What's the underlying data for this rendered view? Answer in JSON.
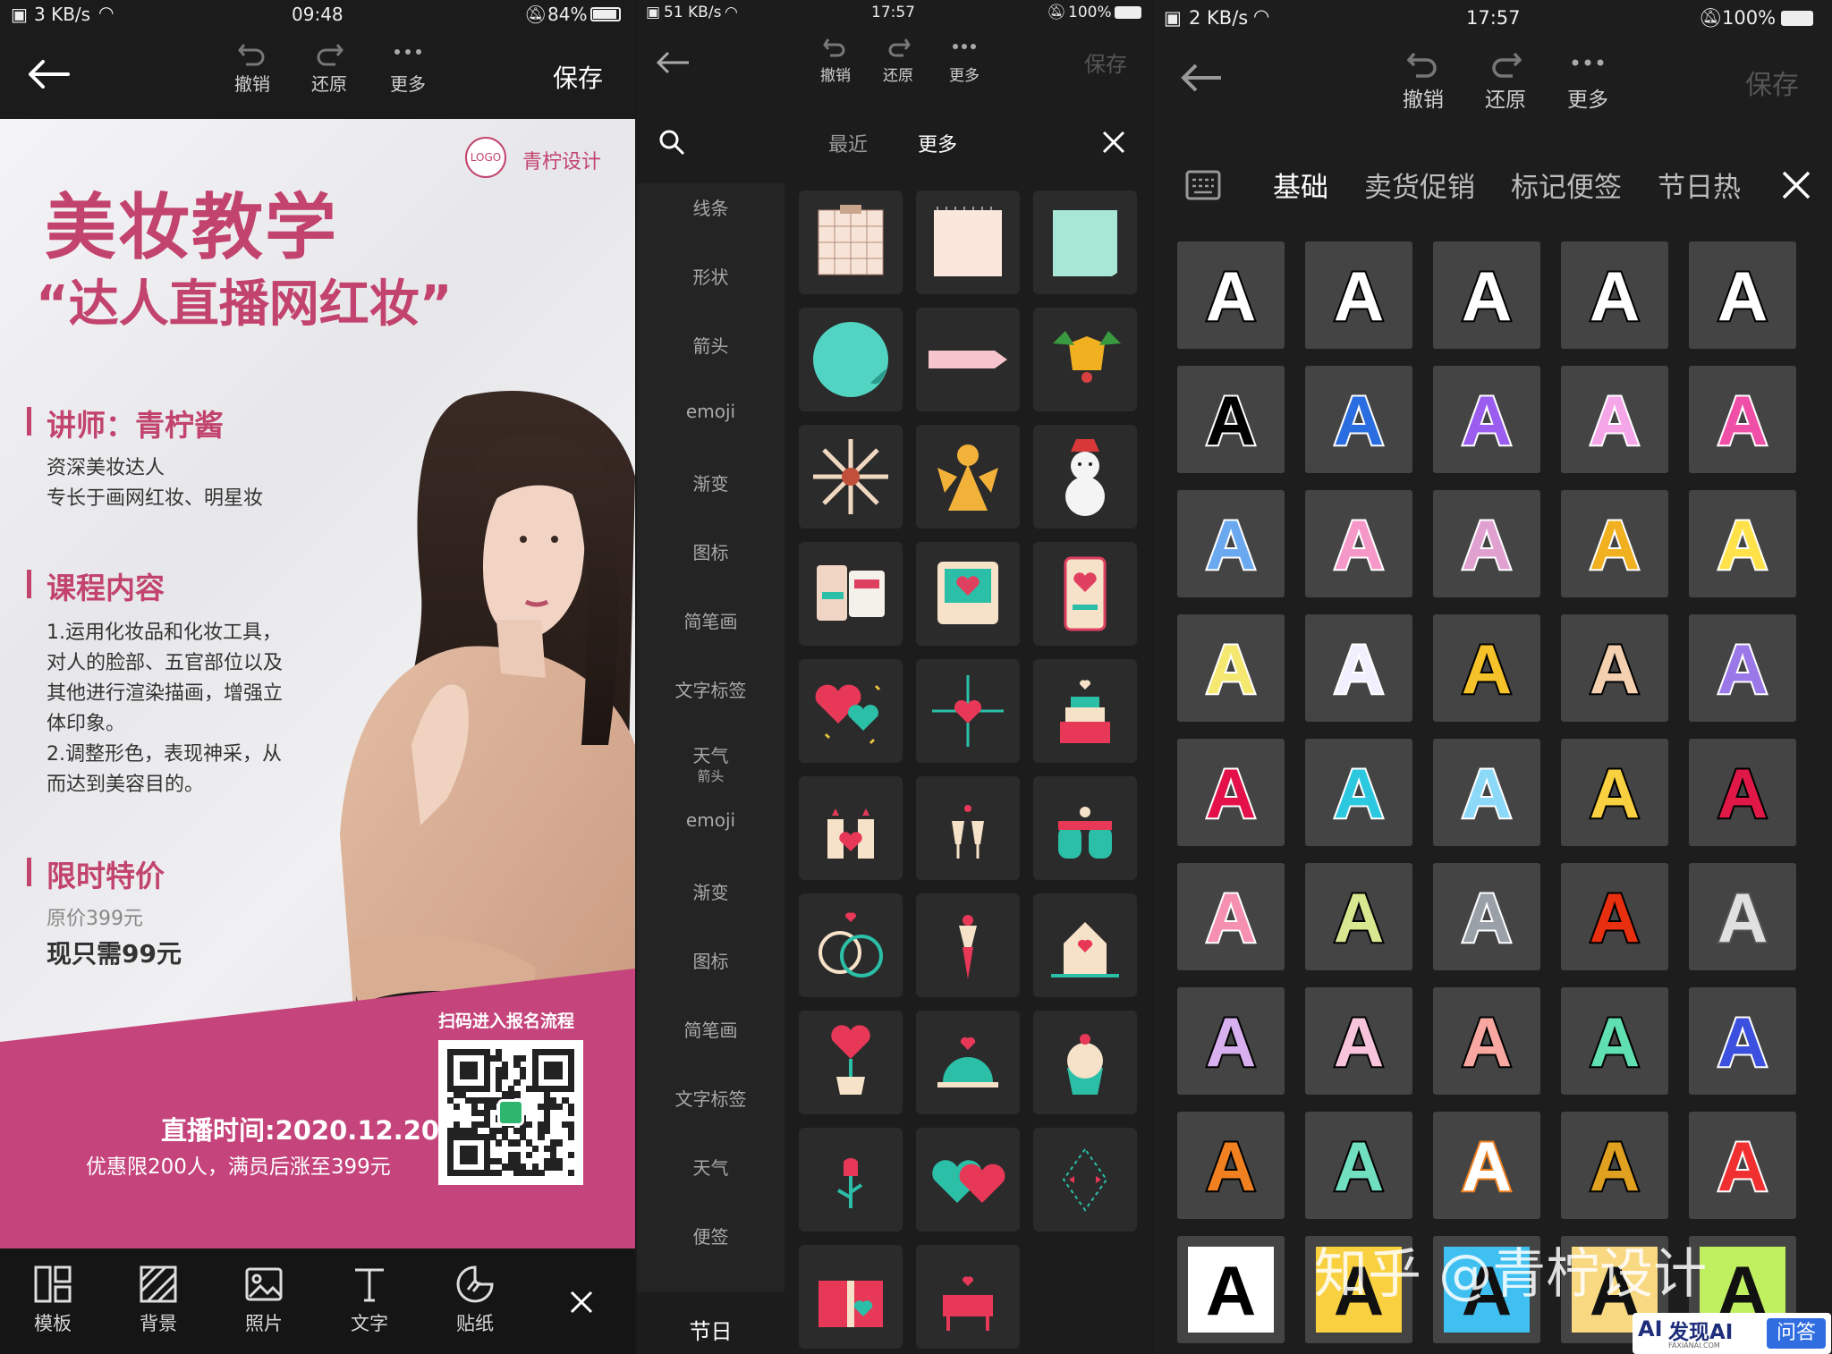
{
  "panel1": {
    "status": {
      "speed": "3 KB/s",
      "time": "09:48",
      "battery": "84%"
    },
    "toolbar": {
      "undo": "撤销",
      "redo": "还原",
      "more": "更多",
      "save": "保存"
    },
    "poster": {
      "logo_badge": "LOGO",
      "brand": "青柠设计",
      "title": "美妆教学",
      "subtitle": "“达人直播网红妆”",
      "lecturer_heading": "讲师：青柠酱",
      "lecturer_lines": [
        "资深美妆达人",
        "专长于画网红妆、明星妆"
      ],
      "course_heading": "课程内容",
      "course_lines": [
        "1.运用化妆品和化妆工具，",
        "对人的脸部、五官部位以及",
        "其他进行渲染描画，增强立",
        "体印象。",
        "2.调整形色，表现神采，从",
        "而达到美容目的。"
      ],
      "price_heading": "限时特价",
      "original_price": "原价399元",
      "now_price": "现只需99元",
      "qr_caption": "扫码进入报名流程",
      "live_time": "直播时间:2020.12.20",
      "offer": "优惠限200人，满员后涨至399元"
    },
    "bottom": {
      "template": "模板",
      "background": "背景",
      "photo": "照片",
      "text": "文字",
      "sticker": "贴纸"
    }
  },
  "panel2": {
    "status": {
      "speed": "51 KB/s",
      "time": "17:57",
      "battery": "100%"
    },
    "toolbar": {
      "undo": "撤销",
      "redo": "还原",
      "more": "更多",
      "save": "保存"
    },
    "tabs": {
      "recent": "最近",
      "more": "更多"
    },
    "categories": [
      "线条",
      "形状",
      "箭头",
      "emoji",
      "渐变",
      "图标",
      "简笔画",
      "文字标签",
      "天气",
      "emoji",
      "渐变",
      "图标",
      "简笔画",
      "文字标签",
      "天气",
      "便签"
    ],
    "weather_sub": "箭头",
    "selected_category": "节日",
    "stickers": [
      "grid-note",
      "lined-note",
      "mint-note",
      "curl-circle",
      "pink-arrow-tag",
      "christmas-bell",
      "snowflake",
      "angel",
      "snowman",
      "chat-phones",
      "valentine-screen",
      "phone-heart",
      "hearts-balloons",
      "heart-target",
      "cake",
      "candles",
      "champagne",
      "gloves",
      "rings",
      "bouquet",
      "love-house",
      "heart-plant",
      "cloche",
      "cupcake",
      "rose",
      "twin-hearts",
      "arrow-divider",
      "gift-box",
      "table"
    ]
  },
  "panel3": {
    "status": {
      "speed": "2 KB/s",
      "time": "17:57",
      "battery": "100%"
    },
    "toolbar": {
      "undo": "撤销",
      "redo": "还原",
      "more": "更多",
      "save": "保存"
    },
    "tabs": [
      "基础",
      "卖货促销",
      "标记便签",
      "节日热"
    ],
    "active_tab": "基础",
    "glyph": "A",
    "watermark": "知乎 @青柠设计",
    "badge": {
      "brand": "发现AI",
      "qa": "问答",
      "domain": "FAXIANAI.COM"
    }
  }
}
